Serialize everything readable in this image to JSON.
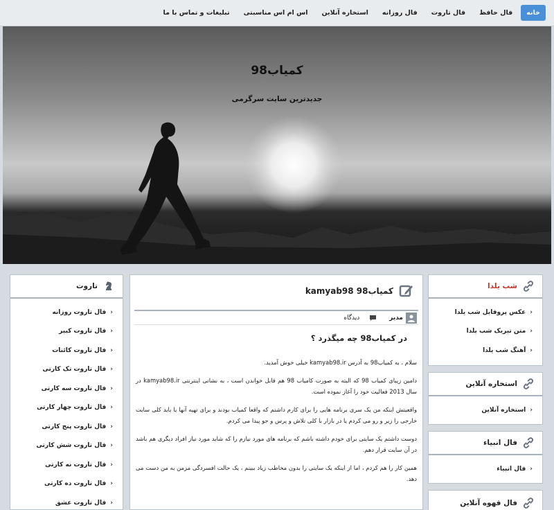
{
  "nav": {
    "items": [
      {
        "label": "خانه",
        "active": true
      },
      {
        "label": "فال حافظ",
        "active": false
      },
      {
        "label": "فال تاروت",
        "active": false
      },
      {
        "label": "فال روزانه",
        "active": false
      },
      {
        "label": "استخاره آنلاین",
        "active": false
      },
      {
        "label": "اس ام اس مناسبتی",
        "active": false
      },
      {
        "label": "تبلیغات و تماس با ما",
        "active": false
      }
    ]
  },
  "hero": {
    "title": "کمیاب98",
    "subtitle": "جدیدترین سایت سرگرمی"
  },
  "left_sidebar": {
    "title": "تاروت",
    "items": [
      "فال تاروت روزانه",
      "فال تاروت کبیر",
      "فال تاروت کائنات",
      "فال تاروت تک کارتی",
      "فال تاروت سه کارتی",
      "فال تاروت چهار کارتی",
      "فال تاروت پنج کارتی",
      "فال تاروت شش کارتی",
      "فال تاروت نه کارتی",
      "فال تاروت ده کارتی",
      "فال تاروت عشق"
    ]
  },
  "main": {
    "title": "کمیاب98 kamyab98",
    "author": "مدیر",
    "comments": "دیدگاه",
    "heading": "در کمیاب98 چه میگذرد ؟",
    "paragraphs": [
      "سلام ، به کمیاب98 به آدرس kamyab98.ir خیلی خوش آمدید.",
      "دامین زیبای کمیاب 98 که البته به صورت کامیاب 98 هم قابل خواندن است ، به نشانی اینترنتی kamyab98.ir در سال 2013 فعالیت خود را آغاز نموده است.",
      "واقعیتش اینکه من یک سری برنامه هایی را برای کارم داشتم که واقعا کمیاب بودند و برای تهیه آنها یا باید کلی سایت خارجی را زیر و رو می کردم یا در بازار با کلی تلاش و پرس و جو پیدا می کردم.",
      "دوست داشتم یک سایتی برای خودم داشته باشم که برنامه های مورد نیازم را که شاید مورد نیاز افراد دیگری هم باشد در آن سایت قرار دهم.",
      "همین کار را هم کردم ، اما از اینکه یک سایتی را بدون مخاطب زیاد ببینم ، یک حالت افسردگی مزمن به من دست می دهد."
    ]
  },
  "right_sidebar": {
    "boxes": [
      {
        "title": "شب یلدا",
        "items": [
          "عکس پروفایل شب یلدا",
          "متن تبریک شب یلدا",
          "آهنگ شب یلدا"
        ]
      },
      {
        "title": "استخاره آنلاین",
        "items": [
          "استخاره آنلاین"
        ]
      },
      {
        "title": "فال انبیاء",
        "items": [
          "فال انبیاء"
        ]
      },
      {
        "title": "فال قهوه آنلاین",
        "items": []
      }
    ]
  },
  "colors": {
    "accent": "#4a90d9",
    "title_red": "#c0392b"
  }
}
